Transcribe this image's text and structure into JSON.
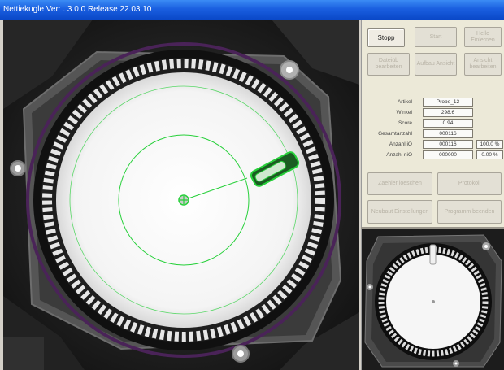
{
  "window": {
    "title": "Nettiekugle Ver: . 3.0.0 Release 22.03.10"
  },
  "toolbar": {
    "buttons": [
      {
        "label": "Stopp",
        "enabled": true
      },
      {
        "label": "Start",
        "enabled": false
      },
      {
        "label": "Hello Einlernen",
        "enabled": false
      },
      {
        "label": "Dateiüb bearbeiten",
        "enabled": false
      },
      {
        "label": "Aufbau Ansicht",
        "enabled": false
      },
      {
        "label": "Ansicht bearbeiten",
        "enabled": false
      }
    ]
  },
  "fields": {
    "artikel": {
      "label": "Artikel",
      "value": "Probe_12"
    },
    "winkel": {
      "label": "Winkel",
      "value": "298.6"
    },
    "score": {
      "label": "Score",
      "value": "0.94"
    },
    "gesamtanzahl": {
      "label": "Gesamtanzahl",
      "value": "000116"
    },
    "anzahl_io": {
      "label": "Anzahl iO",
      "value": "000116",
      "extra": "100.0 %"
    },
    "anzahl_nio": {
      "label": "Anzahl niO",
      "value": "000000",
      "extra": "0.00 %"
    }
  },
  "lower_buttons": [
    {
      "label": "Zaehler loeschen",
      "enabled": false
    },
    {
      "label": "Protokoll",
      "enabled": false
    },
    {
      "label": "Neubaut Einstellungen",
      "enabled": false
    },
    {
      "label": "Programm beenden",
      "enabled": false
    }
  ],
  "colors": {
    "overlay_green": "#27d03a",
    "gear_ring": "#1a1a1a",
    "purple_ring": "#5a2a6a"
  }
}
